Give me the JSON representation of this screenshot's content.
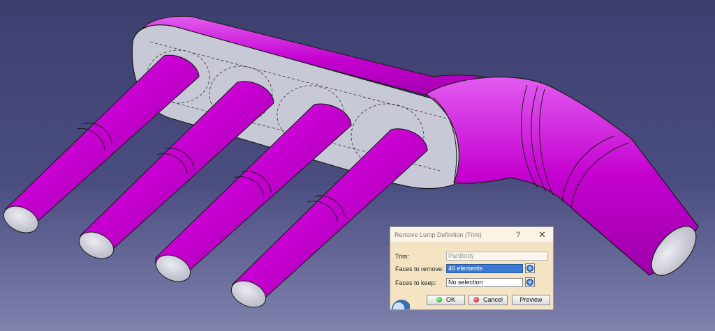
{
  "app": {
    "background_top": "#3c3f6e",
    "background_bottom": "#7f82ac"
  },
  "model": {
    "body_color": "#c800d2",
    "flat_face_color": "#c8c9d6",
    "edge_color": "#1a1a1a",
    "pipe_count": 4
  },
  "dialog": {
    "title": "Remove Lump Definition (Trim)",
    "help_label": "?",
    "close_label": "✕",
    "trim_label": "Trim:",
    "trim_value": "PartBody",
    "faces_remove_label": "Faces to remove:",
    "faces_remove_value": "46 elements",
    "faces_keep_label": "Faces to keep:",
    "faces_keep_value": "No selection",
    "ok_label": "OK",
    "cancel_label": "Cancel",
    "preview_label": "Preview",
    "ok_color": "#1a8a1a",
    "cancel_color": "#b01010"
  }
}
